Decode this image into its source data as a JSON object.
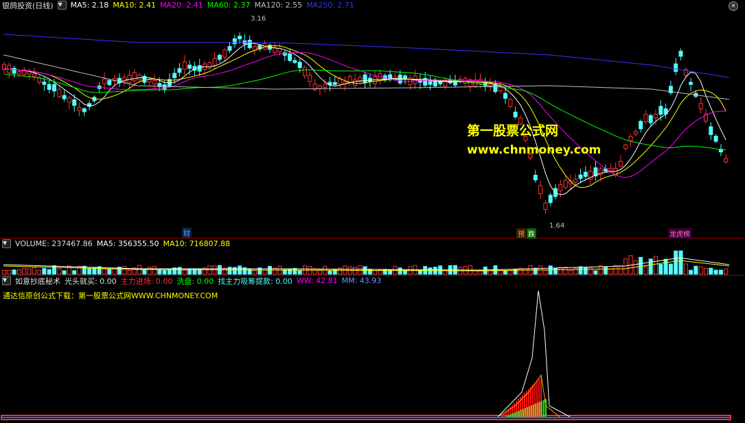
{
  "price_panel": {
    "stock_name": "银鸽投资(日线)",
    "ma5": "MA5: 2.18",
    "ma10": "MA10: 2.41",
    "ma20": "MA20: 2.41",
    "ma60": "MA60: 2.37",
    "ma120": "MA120: 2.55",
    "ma250": "MA250: 2.71",
    "high_label": "3.16",
    "low_label": "1.64",
    "event_cai": "财",
    "event_yu": "预",
    "event_die": "跌",
    "event_shang": "龙虎榜",
    "colors": {
      "ma5": "#ffffff",
      "ma10": "#ffff00",
      "ma20": "#ff00ff",
      "ma60": "#00ff00",
      "ma120": "#c0c0c0",
      "ma250": "#3333ff",
      "up": "#ff3333",
      "down": "#54fcfc"
    }
  },
  "watermark": {
    "line1": "第一股票公式网",
    "line2": "www.chnmoney.com"
  },
  "volume_panel": {
    "volume": "VOLUME: 237467.86",
    "ma5": "MA5: 356355.50",
    "ma10": "MA10: 716807.88"
  },
  "indicator_panel": {
    "name": "如意抄底秘术",
    "guangtou": "光头就买: 0.00",
    "zhuli": "主力进场: 0.00",
    "xipan": "洗盘: 0.00",
    "zhaozhuli": "找主力吸筹提款: 0.00",
    "ww": "WW: 42.81",
    "mm": "MM: 43.93",
    "subtitle": "通达信原创公式下载：第一股票公式网WWW.CHNMONEY.COM"
  }
}
